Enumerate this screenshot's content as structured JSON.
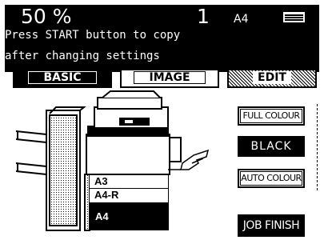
{
  "status": {
    "zoom_label": "50 %",
    "copy_count": "1",
    "paper_size": "A4",
    "tray_icon": "paper-tray-icon",
    "message_line1": "Press START button to copy",
    "message_line2": "after changing settings"
  },
  "tabs": [
    {
      "label": "BASIC",
      "active": true
    },
    {
      "label": "IMAGE",
      "active": false
    },
    {
      "label": "EDIT",
      "active": false
    }
  ],
  "machine": {
    "slots": [
      {
        "label": "A3",
        "selected": false
      },
      {
        "label": "A4-R",
        "selected": false
      },
      {
        "label": "A4",
        "selected": true
      }
    ]
  },
  "controls": {
    "full_colour": "FULL COLOUR",
    "black": "BLACK",
    "auto_colour": "AUTO COLOUR",
    "job_finish": "JOB FINISH"
  }
}
